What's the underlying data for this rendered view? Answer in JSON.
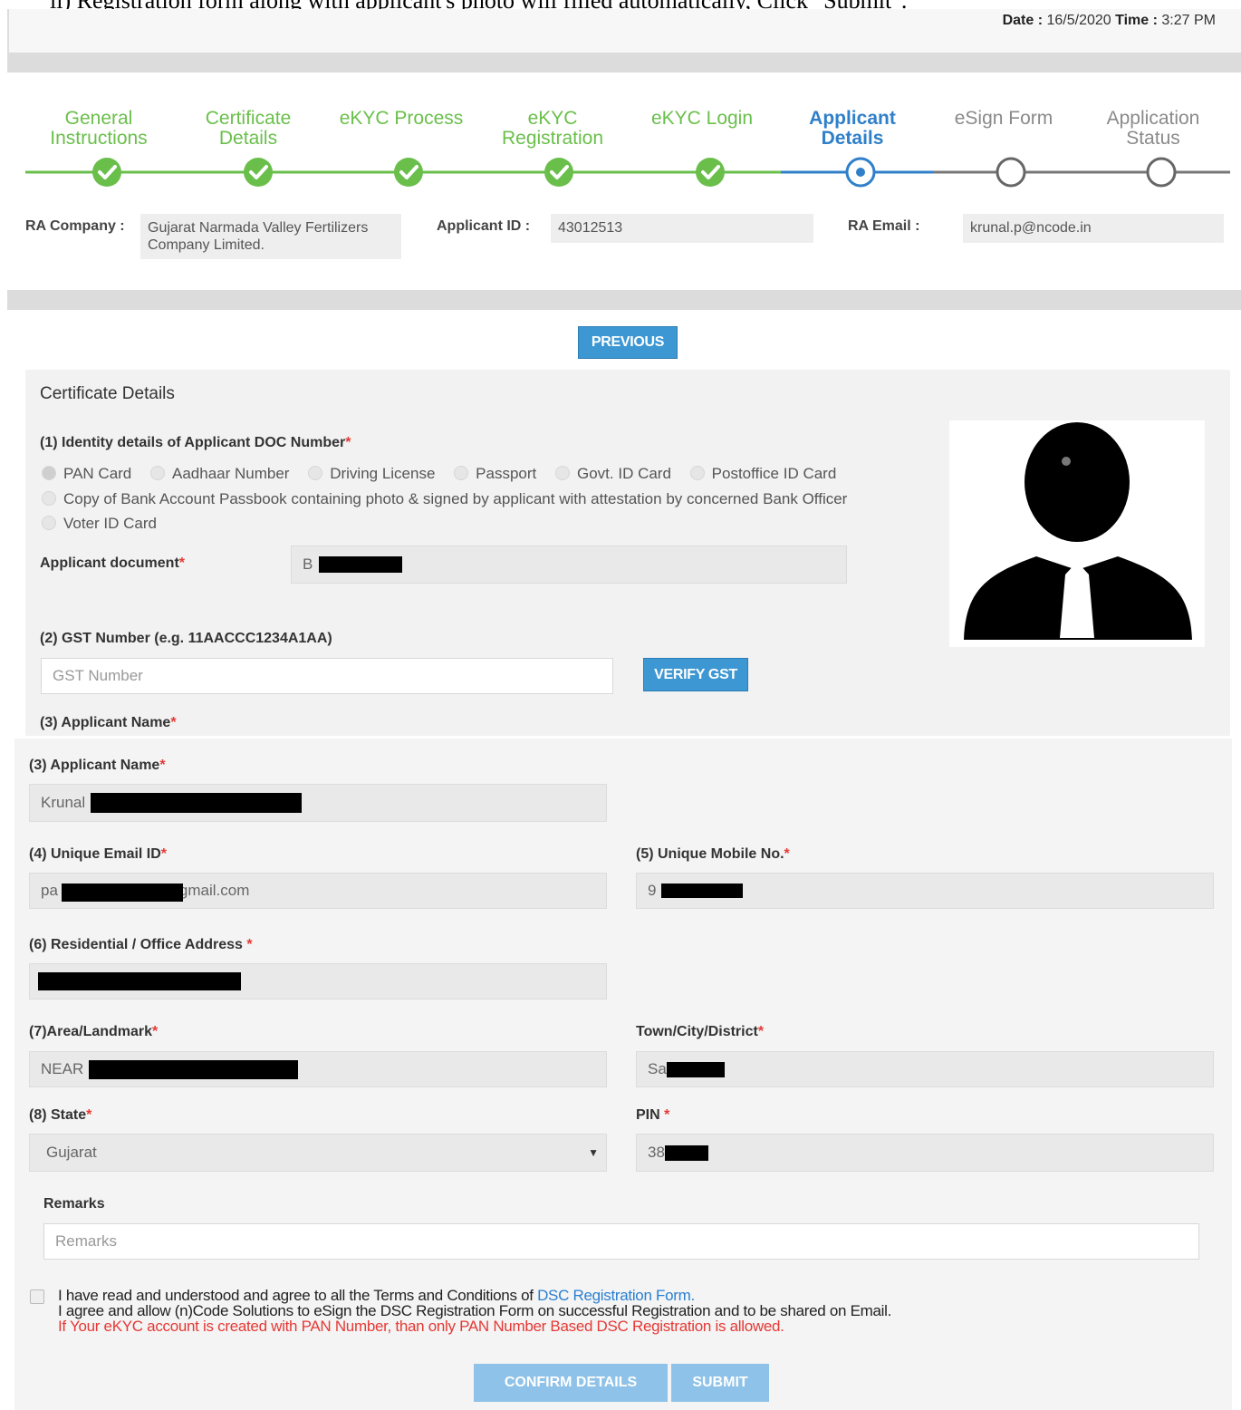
{
  "cut_caption": "ii) Registration form along with applicant's photo will filled automatically, Click \"Submit\".",
  "header": {
    "date_label": "Date :",
    "date_value": "16/5/2020",
    "time_label": "Time :",
    "time_value": "3:27 PM"
  },
  "steps": [
    {
      "label": "General Instructions",
      "state": "done"
    },
    {
      "label": "Certificate Details",
      "state": "done"
    },
    {
      "label": "eKYC Process",
      "state": "done"
    },
    {
      "label": "eKYC Registration",
      "state": "done"
    },
    {
      "label": "eKYC Login",
      "state": "done"
    },
    {
      "label": "Applicant Details",
      "state": "active"
    },
    {
      "label": "eSign Form",
      "state": "todo"
    },
    {
      "label": "Application Status",
      "state": "todo"
    }
  ],
  "info": {
    "ra_company_label": "RA Company :",
    "ra_company_value": "Gujarat Narmada Valley Fertilizers Company Limited.",
    "applicant_id_label": "Applicant ID :",
    "applicant_id_value": "43012513",
    "ra_email_label": "RA Email :",
    "ra_email_value": "krunal.p@ncode.in"
  },
  "buttons": {
    "previous": "PREVIOUS",
    "verify_gst": "VERIFY GST",
    "confirm": "CONFIRM DETAILS",
    "submit": "SUBMIT"
  },
  "form": {
    "section_title": "Certificate Details",
    "identity_label": "(1) Identity details of Applicant DOC Number",
    "id_options": [
      "PAN Card",
      "Aadhaar Number",
      "Driving License",
      "Passport",
      "Govt. ID Card",
      "Postoffice ID Card",
      "Copy of Bank Account Passbook containing photo & signed by applicant with attestation by concerned Bank Officer",
      "Voter ID Card"
    ],
    "selected_option": "PAN Card",
    "applicant_document_label": "Applicant document",
    "applicant_document_value": "B",
    "gst_label": "(2) GST Number (e.g. 11AACCC1234A1AA)",
    "gst_placeholder": "GST Number",
    "name_label": "(3) Applicant Name",
    "name_value": "Krunal",
    "email_label": "(4) Unique Email ID",
    "email_prefix": "pa",
    "email_suffix": "gmail.com",
    "mobile_label": "(5) Unique Mobile No.",
    "mobile_value": "9",
    "address_label": "(6) Residential / Office Address",
    "area_label": "(7)Area/Landmark",
    "area_value": "NEAR",
    "city_label": "Town/City/District",
    "city_value": "Sa",
    "state_label": "(8) State",
    "state_value": "Gujarat",
    "pin_label": "PIN",
    "pin_value": "38",
    "remarks_label": "Remarks",
    "remarks_placeholder": "Remarks"
  },
  "terms": {
    "line1_text": "I have read and understood and agree to all the Terms and Conditions of ",
    "line1_link": "DSC Registration Form.",
    "line2": "I agree and allow (n)Code Solutions to eSign the DSC Registration Form on successful Registration and to be shared on Email.",
    "line3": "If Your eKYC account is created with PAN Number, than only PAN Number Based DSC Registration is allowed."
  },
  "colors": {
    "done": "#6abf4b",
    "active": "#2f7fc9",
    "todo": "#8a8a8a",
    "button": "#3d97d3",
    "required": "#e53935"
  }
}
